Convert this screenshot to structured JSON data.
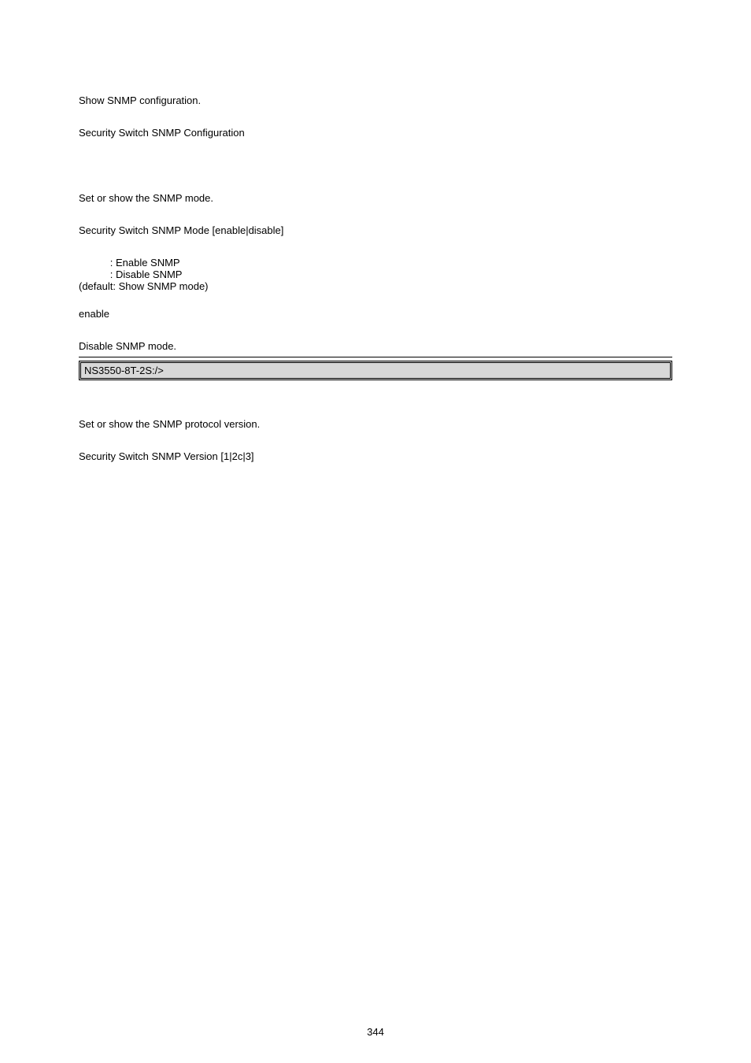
{
  "section1": {
    "desc": "Show SNMP configuration.",
    "syntax": "Security Switch SNMP Configuration"
  },
  "section2": {
    "desc": "Set or show the SNMP mode.",
    "syntax": "Security Switch SNMP Mode [enable|disable]",
    "param_line1": "           : Enable SNMP",
    "param_line2": "           : Disable SNMP",
    "param_line3": "(default: Show SNMP mode)",
    "default_mode": "enable",
    "example_desc": "Disable SNMP mode.",
    "example_cmd": "NS3550-8T-2S:/>"
  },
  "section3": {
    "desc": "Set or show the SNMP protocol version.",
    "syntax": "Security Switch SNMP Version [1|2c|3]"
  },
  "page_number": "344"
}
